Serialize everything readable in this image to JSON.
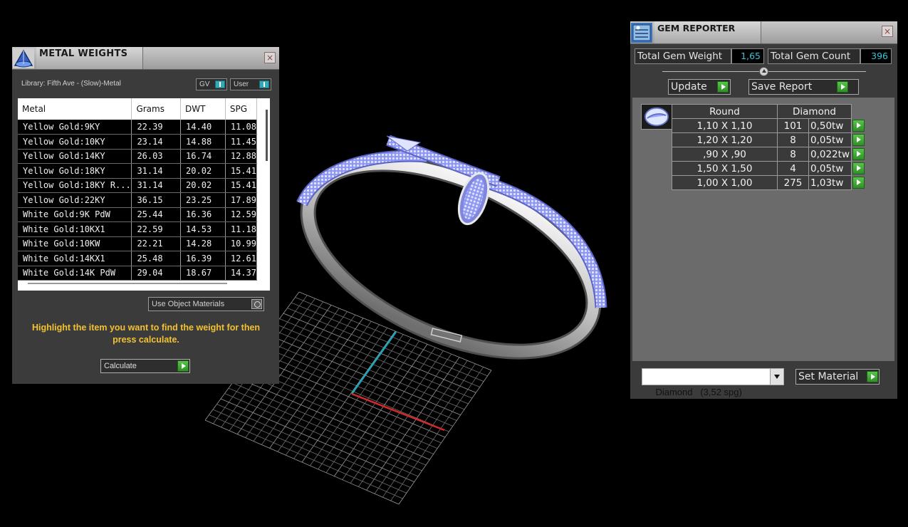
{
  "metal_weights": {
    "title": "METAL WEIGHTS",
    "close": "×",
    "library_label": "Library: Fifth Ave - (Slow)-Metal",
    "gv_label": "GV",
    "user_label": "User",
    "columns": [
      "Metal",
      "Grams",
      "DWT",
      "SPG"
    ],
    "rows": [
      [
        "Yellow Gold:9KY",
        "22.39",
        "14.40",
        "11.08"
      ],
      [
        "Yellow Gold:10KY",
        "23.14",
        "14.88",
        "11.45"
      ],
      [
        "Yellow Gold:14KY",
        "26.03",
        "16.74",
        "12.88"
      ],
      [
        "Yellow Gold:18KY",
        "31.14",
        "20.02",
        "15.41"
      ],
      [
        "Yellow Gold:18KY R...",
        "31.14",
        "20.02",
        "15.41"
      ],
      [
        "Yellow Gold:22KY",
        "36.15",
        "23.25",
        "17.89"
      ],
      [
        "White Gold:9K PdW",
        "25.44",
        "16.36",
        "12.59"
      ],
      [
        "White Gold:10KX1",
        "22.59",
        "14.53",
        "11.18"
      ],
      [
        "White Gold:10KW",
        "22.21",
        "14.28",
        "10.99"
      ],
      [
        "White Gold:14KX1",
        "25.48",
        "16.39",
        "12.61"
      ],
      [
        "White Gold:14K PdW",
        "29.04",
        "18.67",
        "14.37"
      ]
    ],
    "use_object_materials": "Use Object Materials",
    "hint": "Highlight the item you want to find the weight for then press calculate.",
    "calculate_label": "Calculate"
  },
  "gem_reporter": {
    "title": "GEM REPORTER",
    "close": "×",
    "total_weight_label": "Total Gem Weight",
    "total_weight_value": "1,65",
    "total_count_label": "Total Gem Count",
    "total_count_value": "396",
    "update_label": "Update",
    "save_report_label": "Save Report",
    "table_header": [
      "Round",
      "Diamond"
    ],
    "rows": [
      [
        "1,10 X 1,10",
        "101",
        "0,50tw"
      ],
      [
        "1,20 X 1,20",
        "8",
        "0,05tw"
      ],
      [
        ",90 X ,90",
        "8",
        "0,022tw"
      ],
      [
        "1,50 X 1,50",
        "4",
        "0,05tw"
      ],
      [
        "1,00 X 1,00",
        "275",
        "1,03tw"
      ]
    ],
    "material_value": "Diamond   (3,52 spg)",
    "set_material_label": "Set Material"
  },
  "colors": {
    "accent_teal": "#38c6d8",
    "hint_yellow": "#f2c231",
    "go_green": "#3fae33",
    "gem_pave": "#9aa6ff"
  }
}
